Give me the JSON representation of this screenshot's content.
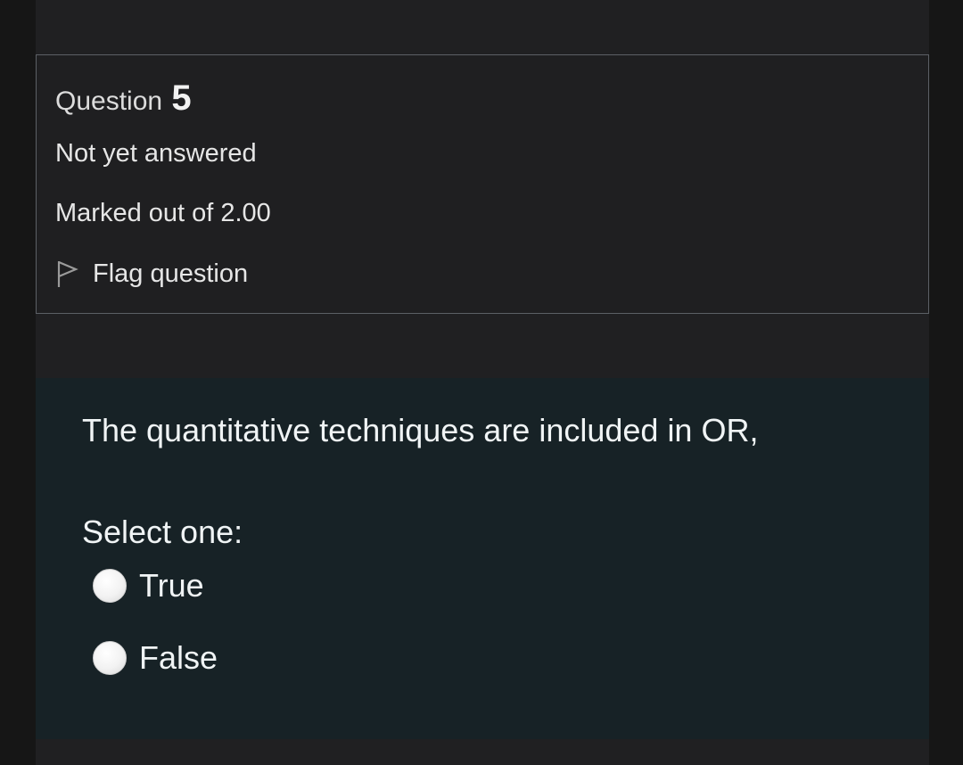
{
  "question_info": {
    "label": "Question",
    "number": "5",
    "state": "Not yet answered",
    "grade": "Marked out of 2.00",
    "flag_label": "Flag question"
  },
  "question": {
    "text": "The quantitative techniques are included in OR,",
    "prompt": "Select one:",
    "options": [
      {
        "label": "True",
        "selected": false
      },
      {
        "label": "False",
        "selected": false
      }
    ]
  },
  "icons": {
    "flag": "flag-outline-icon"
  },
  "colors": {
    "page_background": "#202022",
    "info_border": "#5c6066",
    "content_background": "#172226",
    "text": "#f0f4f5"
  }
}
